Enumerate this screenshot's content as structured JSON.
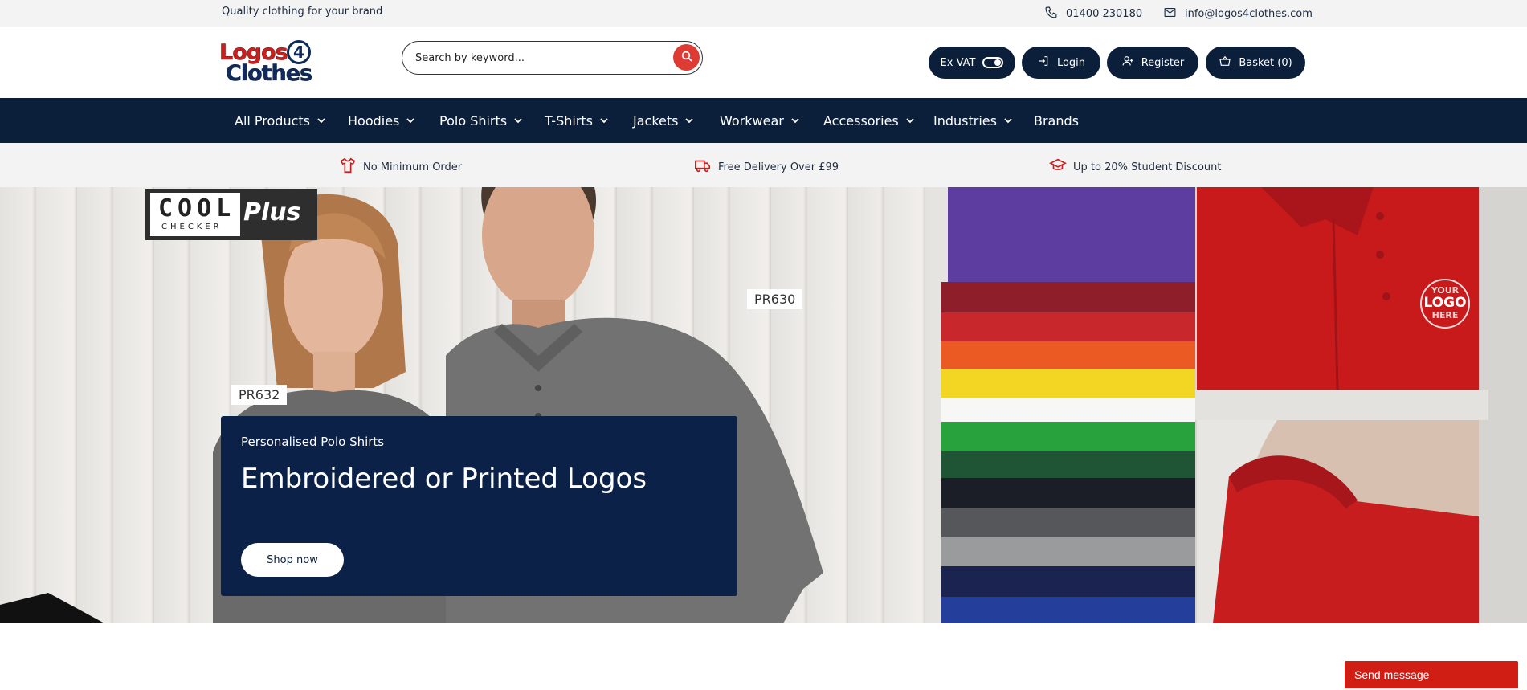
{
  "topbar": {
    "tagline": "Quality clothing for your brand",
    "phone": "01400 230180",
    "email": "info@logos4clothes.com"
  },
  "header": {
    "logo_top": "Logos",
    "logo_bottom": "Clothes",
    "logo_badge": "4",
    "search_placeholder": "Search by keyword...",
    "vat_label": "Ex VAT",
    "login_label": "Login",
    "register_label": "Register",
    "basket_label": "Basket (0)"
  },
  "nav": {
    "items": [
      {
        "label": "All Products"
      },
      {
        "label": "Hoodies"
      },
      {
        "label": "Polo Shirts"
      },
      {
        "label": "T-Shirts"
      },
      {
        "label": "Jackets"
      },
      {
        "label": "Workwear"
      },
      {
        "label": "Accessories"
      },
      {
        "label": "Industries"
      },
      {
        "label": "Brands"
      }
    ]
  },
  "usp": {
    "items": [
      {
        "label": "No Minimum Order",
        "icon": "tshirt-icon"
      },
      {
        "label": "Free Delivery Over £99",
        "icon": "truck-icon"
      },
      {
        "label": "Up to 20% Student Discount",
        "icon": "graduation-cap-icon"
      }
    ]
  },
  "hero": {
    "badge_cool": "COOL",
    "badge_checker": "CHECKER",
    "badge_plus": "Plus",
    "tag_a": "PR632",
    "tag_b": "PR630",
    "logo_your": "YOUR",
    "logo_logo": "LOGO",
    "logo_here": "HERE",
    "promo_subtitle": "Personalised Polo Shirts",
    "promo_title": "Embroidered or Printed Logos",
    "promo_button": "Shop now"
  },
  "chat": {
    "label": "Send message"
  },
  "colors": {
    "navy": "#0b1f3a",
    "promo_navy": "#0b2147",
    "brand_red": "#dd3b33",
    "chat_red": "#d01e15"
  }
}
